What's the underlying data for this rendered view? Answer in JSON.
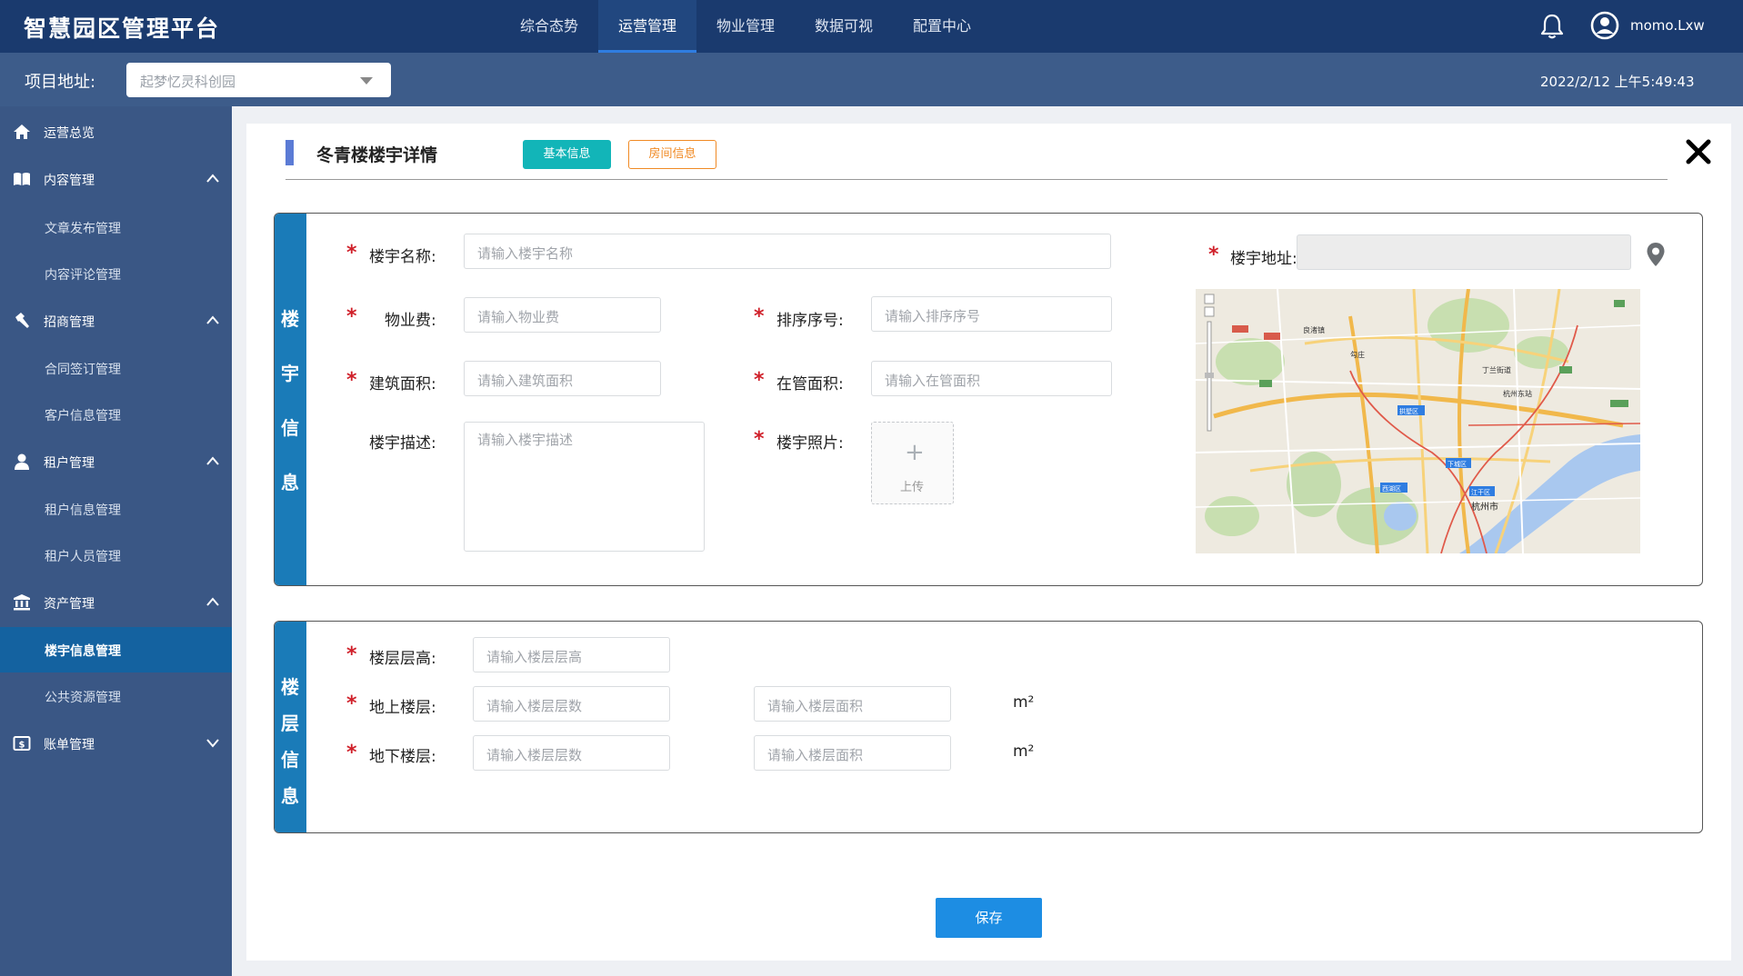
{
  "header": {
    "logo": "智慧园区管理平台",
    "nav": [
      "综合态势",
      "运营管理",
      "物业管理",
      "数据可视",
      "配置中心"
    ],
    "active_nav": "运营管理",
    "username": "momo.Lxw"
  },
  "subbar": {
    "project_label": "项目地址:",
    "project_value": "起梦忆灵科创园",
    "datetime": "2022/2/12 上午5:49:43"
  },
  "sidebar": {
    "items": [
      {
        "label": "运营总览",
        "icon": "home-icon"
      },
      {
        "label": "内容管理",
        "icon": "book-icon"
      },
      {
        "label": "文章发布管理"
      },
      {
        "label": "内容评论管理"
      },
      {
        "label": "招商管理",
        "icon": "hammer-icon"
      },
      {
        "label": "合同签订管理"
      },
      {
        "label": "客户信息管理"
      },
      {
        "label": "租户管理",
        "icon": "user-icon"
      },
      {
        "label": "租户信息管理"
      },
      {
        "label": "租户人员管理"
      },
      {
        "label": "资产管理",
        "icon": "bank-icon"
      },
      {
        "label": "楼宇信息管理"
      },
      {
        "label": "公共资源管理"
      },
      {
        "label": "账单管理",
        "icon": "bill-icon"
      }
    ],
    "active_item": "楼宇信息管理",
    "active_color": "#1462a0"
  },
  "page": {
    "title": "冬青楼楼宇详情",
    "tab_basic": "基本信息",
    "tab_room": "房间信息",
    "save": "保存"
  },
  "building": {
    "section_chars": [
      "楼",
      "宇",
      "信",
      "息"
    ],
    "name_label": "楼宇名称:",
    "name_placeholder": "请输入楼宇名称",
    "address_label": "楼宇地址:",
    "fee_label": "物业费:",
    "fee_placeholder": "请输入物业费",
    "order_label": "排序序号:",
    "order_placeholder": "请输入排序序号",
    "area_label": "建筑面积:",
    "area_placeholder": "请输入建筑面积",
    "managed_label": "在管面积:",
    "managed_placeholder": "请输入在管面积",
    "desc_label": "楼宇描述:",
    "desc_placeholder": "请输入楼宇描述",
    "photo_label": "楼宇照片:",
    "upload_text": "上传",
    "map_places": [
      "良渚镇",
      "勾庄",
      "丁兰街道",
      "杭州东站",
      "拱墅区",
      "下城区",
      "西湖区",
      "江干区",
      "杭州市"
    ]
  },
  "floors": {
    "section_chars": [
      "楼",
      "层",
      "信",
      "息"
    ],
    "height_label": "楼层层高:",
    "height_placeholder": "请输入楼层层高",
    "above_label": "地上楼层:",
    "below_label": "地下楼层:",
    "count_placeholder": "请输入楼层层数",
    "area_placeholder": "请输入楼层面积",
    "unit": "m²"
  },
  "colors": {
    "topbar": "#1a3a6e",
    "sidebar": "#3a5785",
    "accent_teal": "#12b5b8",
    "accent_orange": "#f08a24",
    "section_tag": "#1a7bb8",
    "save": "#1d8de3",
    "required": "#d0212b"
  }
}
